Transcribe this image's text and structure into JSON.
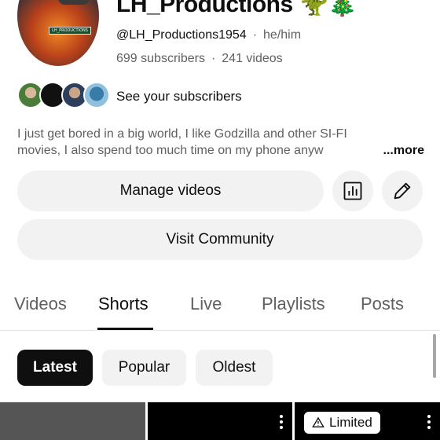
{
  "channel": {
    "name": "LH_Productions 🦖🎄",
    "handle": "@LH_Productions1954",
    "pronouns": "he/him",
    "subscribers": "699 subscribers",
    "videos": "241 videos",
    "avatar_banner_text": "LH_PRODUCTIONS",
    "see_subscribers": "See your subscribers",
    "bio_line1": "I just get bored in a big world, I like Godzilla and other SI-FI",
    "bio_line2": "movies, I also spend too much time on my phone anyw",
    "more_label": "...more"
  },
  "buttons": {
    "manage_videos": "Manage videos",
    "visit_community": "Visit Community",
    "analytics_icon": "analytics-chart-icon",
    "edit_icon": "pencil-edit-icon"
  },
  "tabs": [
    {
      "label": "Videos",
      "active": false
    },
    {
      "label": "Shorts",
      "active": true
    },
    {
      "label": "Live",
      "active": false
    },
    {
      "label": "Playlists",
      "active": false
    },
    {
      "label": "Posts",
      "active": false
    }
  ],
  "filters": [
    {
      "label": "Latest",
      "active": true
    },
    {
      "label": "Popular",
      "active": false
    },
    {
      "label": "Oldest",
      "active": false
    }
  ],
  "shorts": {
    "limited_label": "Limited",
    "limited_icon": "warning-triangle-icon"
  },
  "colors": {
    "text": "#0f0f0f",
    "muted": "#606060",
    "chip_bg": "#f2f2f2",
    "active_chip_bg": "#0f0f0f"
  }
}
